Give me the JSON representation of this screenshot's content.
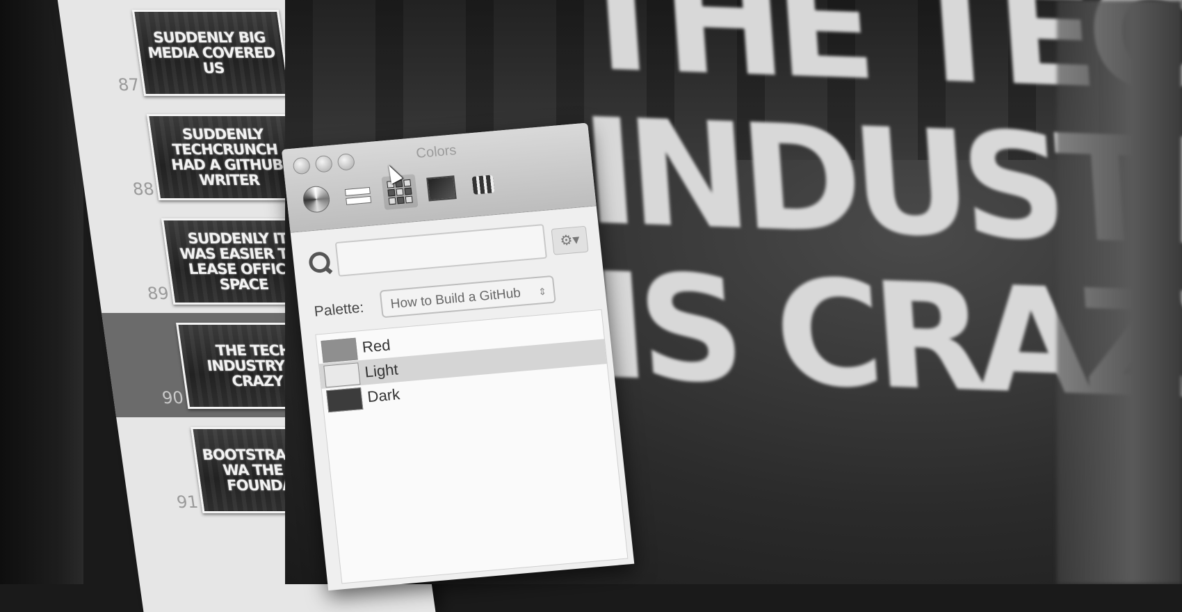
{
  "navigator": {
    "slides": [
      {
        "number": "87",
        "title": "SUDDENLY BIG MEDIA COVERED US",
        "selected": false
      },
      {
        "number": "88",
        "title": "SUDDENLY TECHCRUNCH HAD A GITHUB WRITER",
        "selected": false
      },
      {
        "number": "89",
        "title": "SUDDENLY IT WAS EASIER TO LEASE OFFICE SPACE",
        "selected": false
      },
      {
        "number": "90",
        "title": "THE TECH INDUSTRY IS CRAZY",
        "selected": true
      },
      {
        "number": "91",
        "title": "BOOTSTRAPPING WA THE KEY FOUNDATIO",
        "selected": false
      }
    ]
  },
  "main_slide": {
    "lines": [
      "THE TECH",
      "INDUSTRY",
      "IS CRAZY"
    ]
  },
  "colors_panel": {
    "title": "Colors",
    "search": {
      "value": "",
      "placeholder": ""
    },
    "palette_label": "Palette:",
    "palette_selected": "How to Build a GitHub",
    "colors": [
      {
        "name": "Red",
        "swatch": "#8f8f8f",
        "selected": false
      },
      {
        "name": "Light",
        "swatch": "#e9e9e9",
        "selected": true
      },
      {
        "name": "Dark",
        "swatch": "#3c3c3c",
        "selected": false
      }
    ],
    "modes": [
      "color-wheel",
      "color-sliders",
      "color-palettes",
      "image-palettes",
      "crayons"
    ]
  }
}
